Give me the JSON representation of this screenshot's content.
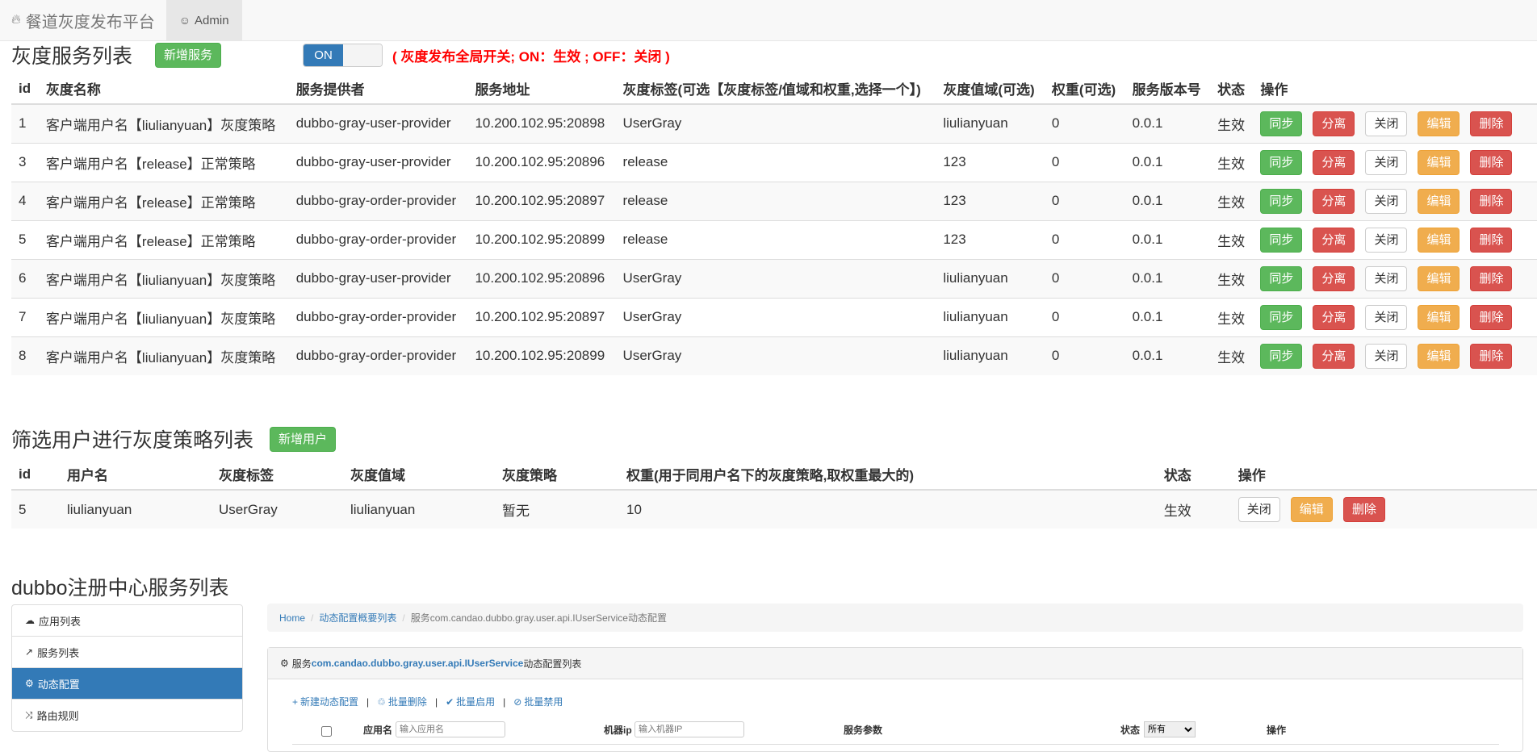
{
  "navbar": {
    "brand": "餐道灰度发布平台",
    "brand_icon": "fire-icon",
    "admin": "Admin",
    "admin_icon": "user-icon"
  },
  "gray_services": {
    "title": "灰度服务列表",
    "add_button": "新增服务",
    "toggle_on": "ON",
    "toggle_note": "( 灰度发布全局开关; ON：生效 ; OFF：关闭 )",
    "columns": [
      "id",
      "灰度名称",
      "服务提供者",
      "服务地址",
      "灰度标签(可选【灰度标签/值域和权重,选择一个】)",
      "灰度值域(可选)",
      "权重(可选)",
      "服务版本号",
      "状态",
      "操作"
    ],
    "action_labels": {
      "sync": "同步",
      "separate": "分离",
      "close": "关闭",
      "edit": "编辑",
      "delete": "删除"
    },
    "rows": [
      [
        "1",
        "客户端用户名【liulianyuan】灰度策略",
        "dubbo-gray-user-provider",
        "10.200.102.95:20898",
        "UserGray",
        "liulianyuan",
        "0",
        "0.0.1",
        "生效"
      ],
      [
        "3",
        "客户端用户名【release】正常策略",
        "dubbo-gray-user-provider",
        "10.200.102.95:20896",
        "release",
        "123",
        "0",
        "0.0.1",
        "生效"
      ],
      [
        "4",
        "客户端用户名【release】正常策略",
        "dubbo-gray-order-provider",
        "10.200.102.95:20897",
        "release",
        "123",
        "0",
        "0.0.1",
        "生效"
      ],
      [
        "5",
        "客户端用户名【release】正常策略",
        "dubbo-gray-order-provider",
        "10.200.102.95:20899",
        "release",
        "123",
        "0",
        "0.0.1",
        "生效"
      ],
      [
        "6",
        "客户端用户名【liulianyuan】灰度策略",
        "dubbo-gray-user-provider",
        "10.200.102.95:20896",
        "UserGray",
        "liulianyuan",
        "0",
        "0.0.1",
        "生效"
      ],
      [
        "7",
        "客户端用户名【liulianyuan】灰度策略",
        "dubbo-gray-order-provider",
        "10.200.102.95:20897",
        "UserGray",
        "liulianyuan",
        "0",
        "0.0.1",
        "生效"
      ],
      [
        "8",
        "客户端用户名【liulianyuan】灰度策略",
        "dubbo-gray-order-provider",
        "10.200.102.95:20899",
        "UserGray",
        "liulianyuan",
        "0",
        "0.0.1",
        "生效"
      ]
    ]
  },
  "user_strategies": {
    "title": "筛选用户进行灰度策略列表",
    "add_button": "新增用户",
    "columns": [
      "id",
      "用户名",
      "灰度标签",
      "灰度值域",
      "灰度策略",
      "权重(用于同用户名下的灰度策略,取权重最大的)",
      "状态",
      "操作"
    ],
    "action_labels": {
      "close": "关闭",
      "edit": "编辑",
      "delete": "删除"
    },
    "rows": [
      [
        "5",
        "liulianyuan",
        "UserGray",
        "liulianyuan",
        "暂无",
        "10",
        "生效"
      ]
    ]
  },
  "registry": {
    "title": "dubbo注册中心服务列表",
    "side_menu": [
      {
        "label": "应用列表",
        "icon": "cloud-icon",
        "active": false
      },
      {
        "label": "服务列表",
        "icon": "share-icon",
        "active": false
      },
      {
        "label": "动态配置",
        "icon": "cogs-icon",
        "active": true
      },
      {
        "label": "路由规则",
        "icon": "random-icon",
        "active": false
      }
    ],
    "breadcrumb": [
      "Home",
      "动态配置概要列表",
      "服务com.candao.dubbo.gray.user.api.IUserService动态配置"
    ],
    "panel_prefix": "服务",
    "panel_service": "com.candao.dubbo.gray.user.api.IUserService",
    "panel_suffix": "动态配置列表",
    "tools": [
      {
        "label": "新建动态配置",
        "icon": "plus-icon"
      },
      {
        "label": "批量删除",
        "icon": "trash-icon"
      },
      {
        "label": "批量启用",
        "icon": "check-icon"
      },
      {
        "label": "批量禁用",
        "icon": "ban-icon"
      }
    ],
    "filter": {
      "app_label": "应用名",
      "app_placeholder": "输入应用名",
      "ip_label": "机器ip",
      "ip_placeholder": "输入机器IP",
      "params_label": "服务参数",
      "status_label": "状态",
      "status_value": "所有",
      "ops_label": "操作"
    }
  }
}
